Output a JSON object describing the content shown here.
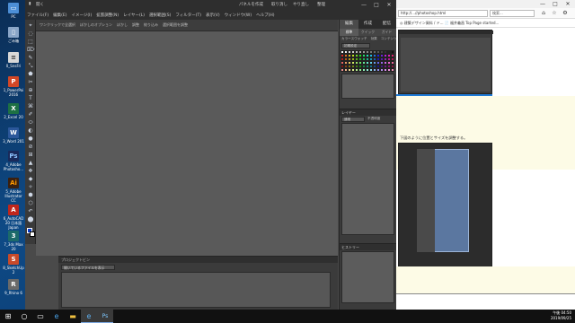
{
  "desktop": {
    "icons": [
      {
        "label": "PC",
        "glyph": "▭",
        "color": "#4d8fd6"
      },
      {
        "label": "ごみ箱",
        "glyph": "▯",
        "color": "#8aa6c8"
      },
      {
        "label": "0_SnsFri",
        "glyph": "≡",
        "color": "#d8d8d8"
      },
      {
        "label": "1_PowerPoi 2016",
        "glyph": "P",
        "color": "#d24726"
      },
      {
        "label": "2_Excel 20",
        "glyph": "X",
        "color": "#1d7044"
      },
      {
        "label": "3_Word 201",
        "glyph": "W",
        "color": "#2b579a"
      },
      {
        "label": "4_Adobe Photosho...",
        "glyph": "Ps",
        "color": "#1a2a5a"
      },
      {
        "label": "5_Adobe Illustrator CC",
        "glyph": "Ai",
        "color": "#3a2010"
      },
      {
        "label": "6_AutoCAD 20 日本語 Japan",
        "glyph": "A",
        "color": "#c0261c"
      },
      {
        "label": "7_3ds Max 20",
        "glyph": "3",
        "color": "#1c6a6a"
      },
      {
        "label": "8_SketchUp 2",
        "glyph": "S",
        "color": "#c84a2a"
      },
      {
        "label": "9_Rhino 6",
        "glyph": "R",
        "color": "#6a6a6a"
      }
    ]
  },
  "photoshop": {
    "menu": [
      "ファイル(F)",
      "編集(E)",
      "イメージ(I)",
      "拡張調整(N)",
      "レイヤー(L)",
      "選択範囲(S)",
      "フィルター(T)",
      "表示(V)",
      "ウィンドウ(W)",
      "ヘルプ(H)"
    ],
    "title_button": "開く",
    "top_buttons": {
      "create_panel": "パネルを作成",
      "undo": "取り消し",
      "redo": "やり直し",
      "organizer": "整理"
    },
    "window_controls": {
      "minimize": "—",
      "maximize": "□",
      "close": "✕"
    },
    "options_bar": [
      "ワンクリックで全選択",
      "ぼかしのオプション",
      "ぼかし",
      "調整",
      "絞り込み",
      "選択範囲を調整"
    ],
    "tools": [
      "⌖",
      "◌",
      "⬚",
      "⌦",
      "✎",
      "⤡",
      "⬟",
      "✂",
      "⊕",
      "T",
      "⌘",
      "✐",
      "⬭",
      "◐",
      "●",
      "⊘",
      "⊞",
      "▲",
      "❖",
      "◆",
      "✧",
      "⬢",
      "⬡",
      "↶",
      "⬤",
      "⬛",
      "◩"
    ],
    "modes": {
      "edit": "編集",
      "create": "作成",
      "share": "配信"
    },
    "subtabs": [
      "標準",
      "クイック",
      "ガイド"
    ],
    "swatches_panel": {
      "title": "カラースウォッチ",
      "sub": [
        "効果",
        "コンテンツ",
        "ライブラリー"
      ],
      "select": "初期設定"
    },
    "layers_panel": {
      "title": "レイヤー",
      "blend_select": "通常",
      "opacity_label": "不透明度"
    },
    "history_panel": {
      "title": "ヒストリー"
    },
    "project_bin": {
      "title": "プロジェクトビン",
      "select": "開いているファイルを表示"
    }
  },
  "browser": {
    "url": "http://...//photoshop.html",
    "search_placeholder": "検索...",
    "favorites_text": "◎ 建築デザイン資料 / ド...   📄 福井義昌 Top Page started...",
    "caption": "下図のように位置とサイズを調整する。",
    "controls": {
      "minimize": "—",
      "maximize": "□",
      "close": "✕"
    },
    "icons": {
      "home": "⌂",
      "star": "☆",
      "gear": "⚙"
    }
  },
  "taskbar": {
    "start": "⊞",
    "search": "○",
    "taskview": "▭",
    "edge": "e",
    "explorer": "▬",
    "ie": "e",
    "photoshop_elements": "Ps",
    "time": "午後 04:50",
    "date": "2019/09/25"
  }
}
